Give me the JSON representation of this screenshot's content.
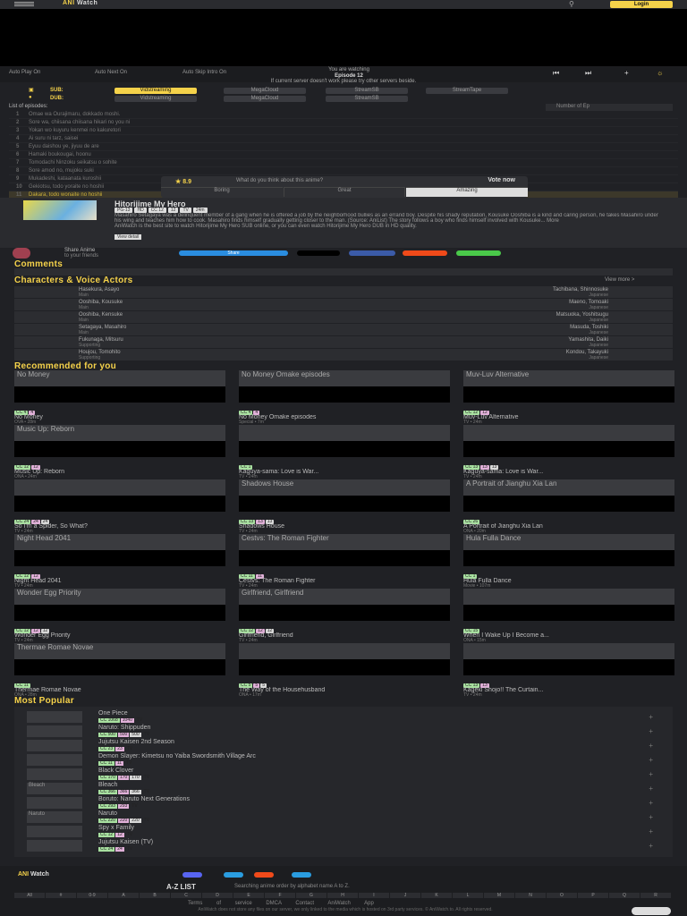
{
  "header": {
    "logo": "ANI",
    "logo2": "Watch",
    "search_icon": "search-icon",
    "login": "Login"
  },
  "controls": {
    "autoplay": "Auto Play  On",
    "autonext": "Auto Next  On",
    "autoskip": "Auto Skip Intro  On",
    "watching": "You are watching",
    "episode": "Episode 12"
  },
  "notice": "If current server doesn't work please try other servers beside.",
  "servers": {
    "sub_label": "SUB:",
    "dub_label": "DUB:",
    "sub": [
      "Vidstreaming",
      "MegaCloud",
      "StreamSB",
      "StreamTape"
    ],
    "dub": [
      "Vidstreaming",
      "MegaCloud",
      "StreamSB"
    ]
  },
  "episodes": {
    "heading": "List of episodes:",
    "range_placeholder": "Number of Ep",
    "items": [
      {
        "n": "1",
        "t": "Omae wa Ourajimaru, dokkado moshi."
      },
      {
        "n": "2",
        "t": "Sore wa, chiisana chiisana hikari no you ni"
      },
      {
        "n": "3",
        "t": "Yokan wo kuyuru kenmei no kakuretori"
      },
      {
        "n": "4",
        "t": "Ai suru ni tarz, saisei"
      },
      {
        "n": "5",
        "t": "Eyuu daishou ye, jiyuu de are"
      },
      {
        "n": "6",
        "t": "Hamaki boukougai, hoonu"
      },
      {
        "n": "7",
        "t": "Tomodachi Ninzoku seikatsu o sohite"
      },
      {
        "n": "8",
        "t": "Sore amod no, mujoku suki"
      },
      {
        "n": "9",
        "t": "Mukadeshi, kataanata kuroshii"
      },
      {
        "n": "10",
        "t": "Gekiotsu, todo yoraite no hoshii"
      },
      {
        "n": "11",
        "t": "Dakara, todo wonaite no hoshii"
      },
      {
        "n": "12",
        "t": "Kokoro de kawatae, yokosshi kanzuko"
      }
    ]
  },
  "rating": {
    "score": "8.9",
    "question": "What do you think about this anime?",
    "vote": "Vote now",
    "options": [
      "Boring",
      "Great",
      "Amazing"
    ]
  },
  "anime": {
    "title": "Hitorijime My Hero",
    "tags": [
      "PG-13",
      "HD",
      "CC 12",
      "12",
      "TV",
      "24m"
    ],
    "desc": "Masahiro Setagaya was a delinquent member of a gang when he is offered a job by the neighborhood bullies as an errand boy. Despite his shady reputation, Kousuke Ooshiba is a kind and caring person, he takes Masahiro under his wing and teaches him how to cook. Masahiro finds himself gradually getting closer to the man. (Source: AniList) The story follows a boy who finds himself involved with Kousuke... More",
    "desc2": "AniWatch is the best site to watch Hitorijime My Hero SUB online, or you can even watch Hitorijime My Hero DUB in HD quality.",
    "detail": "View detail"
  },
  "share": {
    "title": "Share Anime",
    "sub": "to your friends",
    "buttons": [
      "Share",
      "",
      "",
      "",
      ""
    ]
  },
  "comments": "Comments",
  "characters": {
    "title": "Characters & Voice Actors",
    "viewmore": "View more  >",
    "items": [
      {
        "name": "Hasekura, Asayo",
        "role": "Main",
        "va": "Tachibana, Shinnosuke",
        "lang": "Japanese"
      },
      {
        "name": "Ooshiba, Kousuke",
        "role": "Main",
        "va": "Maeno, Tomoaki",
        "lang": "Japanese"
      },
      {
        "name": "Ooshiba, Kensuke",
        "role": "Main",
        "va": "Matsuoka, Yoshitsugu",
        "lang": "Japanese"
      },
      {
        "name": "Setagaya, Masahiro",
        "role": "Main",
        "va": "Masuda, Toshiki",
        "lang": "Japanese"
      },
      {
        "name": "Fukunaga, Mitsuru",
        "role": "Supporting",
        "va": "Yamashita, Daiki",
        "lang": "Japanese"
      },
      {
        "name": "Houjou, Tomohito",
        "role": "Supporting",
        "va": "Kondou, Takayuki",
        "lang": "Japanese"
      }
    ]
  },
  "recommended": {
    "title": "Recommended for you",
    "items": [
      {
        "name": "No Money",
        "meta": "OVA  •  28m",
        "img": "No Money",
        "b": [
          "CC 4",
          "4"
        ]
      },
      {
        "name": "No Money Omake episodes",
        "meta": "Special  •  7m",
        "img": "No Money Omake episodes",
        "b": [
          "CC 4",
          "4"
        ]
      },
      {
        "name": "Muv-Luv Alternative",
        "meta": "TV  •  24m",
        "img": "Muv-Luv Alternative",
        "b": [
          "CC 12",
          "12"
        ]
      },
      {
        "name": "Music Up: Reborn",
        "meta": "ONA  •  24m",
        "img": "Music Up: Reborn",
        "b": [
          "CC 12",
          "12"
        ]
      },
      {
        "name": "Kaguya-sama: Love is War...",
        "meta": "TV  •  24m",
        "img": "",
        "b": [
          "CC 1"
        ]
      },
      {
        "name": "Kaguya-sama: Love is War...",
        "meta": "TV  •  24m",
        "img": "",
        "b": [
          "CC 13",
          "13",
          "13"
        ]
      },
      {
        "name": "So I'm a Spider, So What?",
        "meta": "TV  •  24m",
        "img": "",
        "b": [
          "CC 24",
          "24",
          "24"
        ]
      },
      {
        "name": "Shadows House",
        "meta": "TV  •  24m",
        "img": "Shadows House",
        "b": [
          "CC 13",
          "13",
          "13"
        ]
      },
      {
        "name": "A Portrait of Jianghu Xia Lan",
        "meta": "ONA  •  20m",
        "img": "A Portrait of Jianghu Xia Lan",
        "b": [
          "CC 26"
        ]
      },
      {
        "name": "Night Head 2041",
        "meta": "TV  •  24m",
        "img": "Night Head 2041",
        "b": [
          "CC 12",
          "12"
        ]
      },
      {
        "name": "Cestvs: The Roman Fighter",
        "meta": "TV  •  24m",
        "img": "Cestvs: The Roman Fighter",
        "b": [
          "CC 11",
          "11"
        ]
      },
      {
        "name": "Hula Fulla Dance",
        "meta": "Movie  •  107m",
        "img": "Hula Fulla Dance",
        "b": [
          "CC 1"
        ]
      },
      {
        "name": "Wonder Egg Priority",
        "meta": "TV  •  24m",
        "img": "Wonder Egg Priority",
        "b": [
          "CC 12",
          "12",
          "12"
        ]
      },
      {
        "name": "Girlfriend, Girlfriend",
        "meta": "TV  •  24m",
        "img": "Girlfriend, Girlfriend",
        "b": [
          "CC 12",
          "12",
          "12"
        ]
      },
      {
        "name": "When I Wake Up I Become a...",
        "meta": "ONA  •  15m",
        "img": "",
        "b": [
          "CC 15"
        ]
      },
      {
        "name": "Thermae Romae Novae",
        "meta": "ONA  •  28m",
        "img": "Thermae Romae Novae",
        "b": [
          "CC 11"
        ]
      },
      {
        "name": "The Way of the Househusband",
        "meta": "ONA  •  17m",
        "img": "",
        "b": [
          "CC 5",
          "5",
          "5"
        ]
      },
      {
        "name": "Kageki Shojo!! The Curtain...",
        "meta": "TV  •  24m",
        "img": "",
        "b": [
          "CC 13",
          "13"
        ]
      }
    ]
  },
  "popular": {
    "title": "Most Popular",
    "items": [
      {
        "name": "One Piece",
        "thumb": "",
        "b": [
          "CC 1068",
          "1040"
        ],
        "type": "TV"
      },
      {
        "name": "Naruto: Shippuden",
        "thumb": "",
        "b": [
          "CC 500",
          "500",
          "500"
        ],
        "type": "TV"
      },
      {
        "name": "Jujutsu Kaisen 2nd Season",
        "thumb": "",
        "b": [
          "CC 23",
          "23"
        ],
        "type": "TV"
      },
      {
        "name": "Demon Slayer: Kimetsu no Yaiba Swordsmith Village Arc",
        "thumb": "",
        "b": [
          "CC 11",
          "11"
        ],
        "type": "TV"
      },
      {
        "name": "Black Clover",
        "thumb": "",
        "b": [
          "CC 170",
          "170",
          "170"
        ],
        "type": "TV"
      },
      {
        "name": "Bleach",
        "thumb": "Bleach",
        "b": [
          "CC 366",
          "366",
          "366"
        ],
        "type": "TV"
      },
      {
        "name": "Boruto: Naruto Next Generations",
        "thumb": "",
        "b": [
          "CC 293",
          "293"
        ],
        "type": "TV"
      },
      {
        "name": "Naruto",
        "thumb": "Naruto",
        "b": [
          "CC 220",
          "220",
          "220"
        ],
        "type": "TV"
      },
      {
        "name": "Spy x Family",
        "thumb": "",
        "b": [
          "CC 12",
          "12"
        ],
        "type": "TV"
      },
      {
        "name": "Jujutsu Kaisen (TV)",
        "thumb": "",
        "b": [
          "CC 24",
          "24"
        ],
        "type": "TV"
      }
    ]
  },
  "footer": {
    "logo": "ANI",
    "logo2": "Watch",
    "az": "A-Z LIST",
    "azdesc": "Searching anime order by alphabet name A to Z.",
    "letters": [
      "All",
      "#",
      "0-9",
      "A",
      "B",
      "C",
      "D",
      "E",
      "F",
      "G",
      "H",
      "I",
      "J",
      "K",
      "L",
      "M",
      "N",
      "O",
      "P",
      "Q",
      "R",
      "S",
      "T",
      "U",
      "V",
      "W",
      "X",
      "Y",
      "Z"
    ],
    "links": "Terms of service   DMCA   Contact   AniWatch App",
    "disc": "AniWatch does not store any files on our server, we only linked to the media which is hosted on 3rd party services. © AniWatch.to. All rights reserved."
  }
}
